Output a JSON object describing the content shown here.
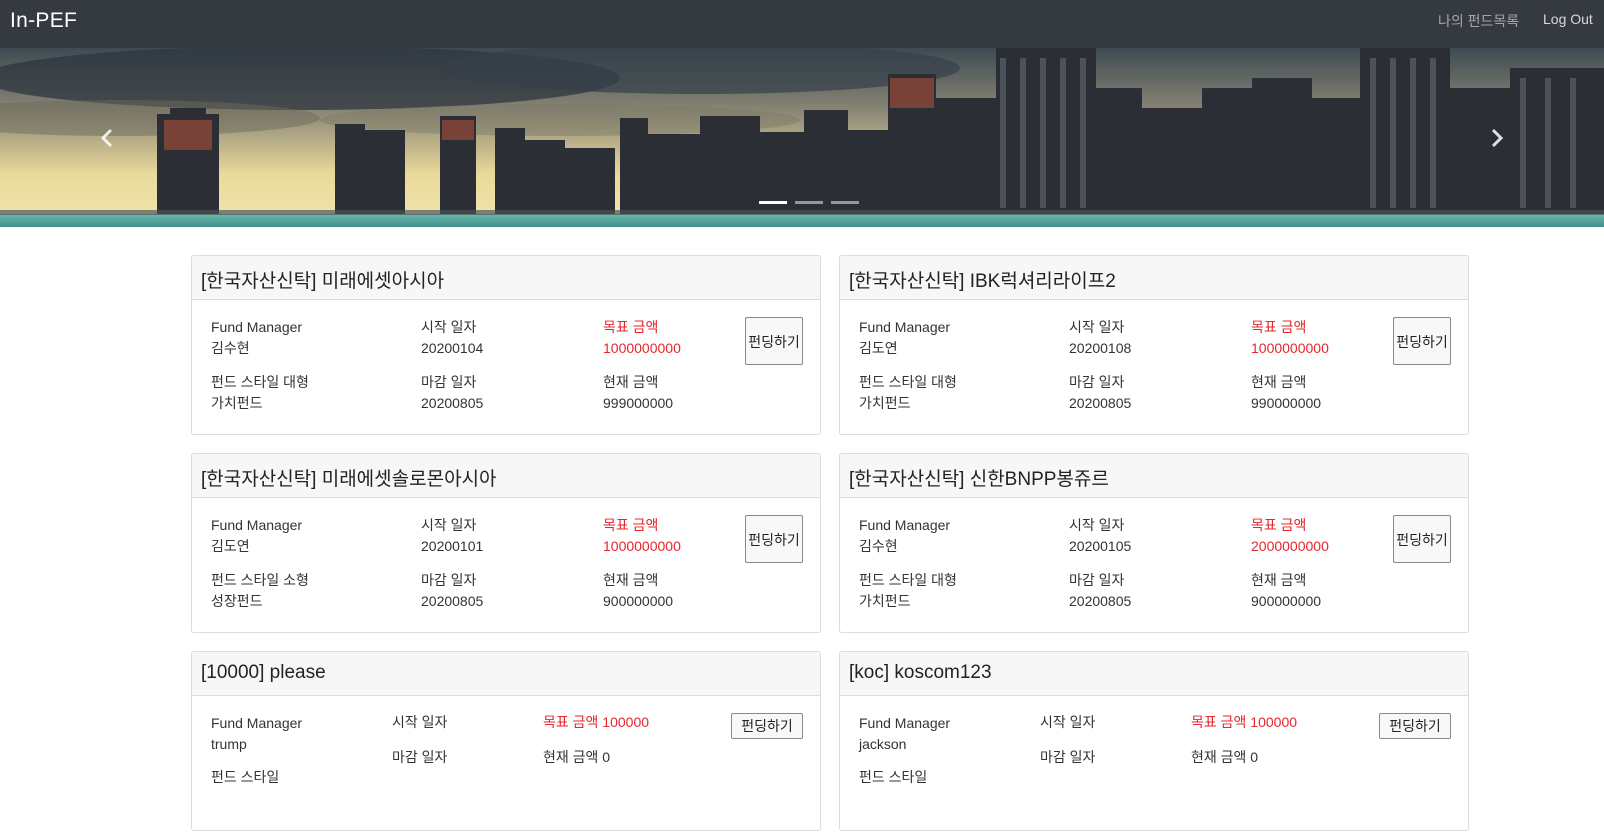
{
  "brand": "In-PEF",
  "nav": {
    "my_funds": "나의 펀드목록",
    "logout": "Log Out"
  },
  "carousel": {
    "indicator_count": 3,
    "active_index": 0
  },
  "colors": {
    "navbar": "#343a40",
    "target_red": "#e6262b"
  },
  "labels": {
    "fund_manager": "Fund Manager",
    "start_date": "시작 일자",
    "end_date": "마감 일자",
    "target_amount": "목표 금액",
    "current_amount": "현재 금액",
    "fund_style": "펀드 스타일"
  },
  "funds": [
    {
      "title": "[한국자산신탁] 미래에셋아시아",
      "manager": "김수현",
      "start": "20200104",
      "target": "1000000000",
      "style": "펀드 스타일 대형",
      "type": "가치펀드",
      "end": "20200805",
      "current": "999000000",
      "button": "펀딩하기"
    },
    {
      "title": "[한국자산신탁] IBK럭셔리라이프2",
      "manager": "김도연",
      "start": "20200108",
      "target": "1000000000",
      "style": "펀드 스타일 대형",
      "type": "가치펀드",
      "end": "20200805",
      "current": "990000000",
      "button": "펀딩하기"
    },
    {
      "title": "[한국자산신탁] 미래에셋솔로몬아시아",
      "manager": "김도연",
      "start": "20200101",
      "target": "1000000000",
      "style": "펀드 스타일 소형",
      "type": "성장펀드",
      "end": "20200805",
      "current": "900000000",
      "button": "펀딩하기"
    },
    {
      "title": "[한국자산신탁] 신한BNPP봉쥬르",
      "manager": "김수현",
      "start": "20200105",
      "target": "2000000000",
      "style": "펀드 스타일 대형",
      "type": "가치펀드",
      "end": "20200805",
      "current": "900000000",
      "button": "펀딩하기"
    },
    {
      "title": "[10000] please",
      "manager": "trump",
      "target_text": "목표 금액 100000",
      "current_text": "현재 금액 0",
      "button": "펀딩하기"
    },
    {
      "title": "[koc] koscom123",
      "manager": "jackson",
      "target_text": "목표 금액 100000",
      "current_text": "현재 금액 0",
      "button": "펀딩하기"
    }
  ]
}
